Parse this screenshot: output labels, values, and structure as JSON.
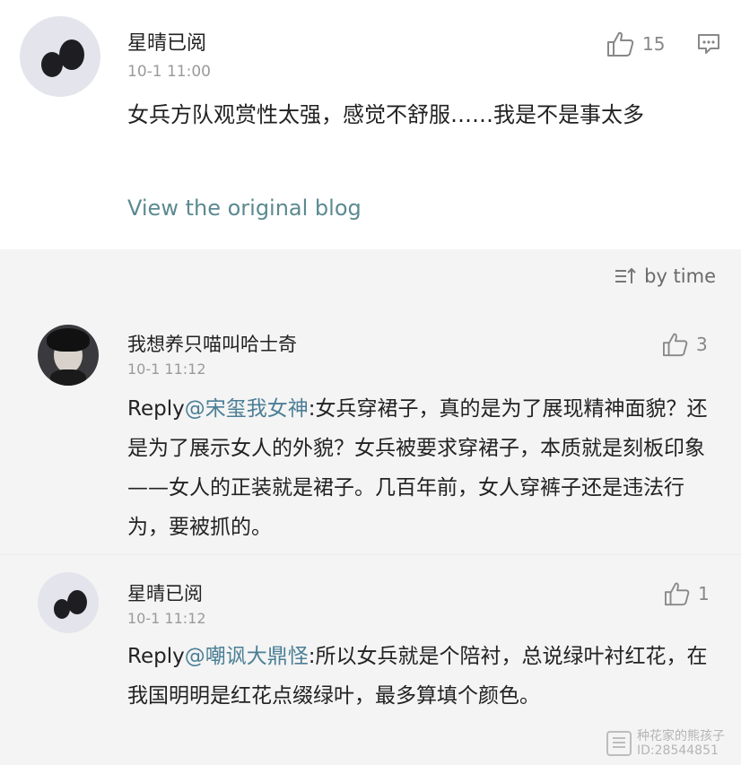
{
  "post": {
    "author": "星晴已阅",
    "time": "10-1 11:00",
    "likes": "15",
    "content": "女兵方队观赏性太强，感觉不舒服……我是不是事太多",
    "view_original": "View the original blog"
  },
  "sort": {
    "label": "by time"
  },
  "replies": [
    {
      "author": "我想养只喵叫哈士奇",
      "time": "10-1 11:12",
      "likes": "3",
      "reply_prefix": "Reply",
      "mention": "@宋玺我女神",
      "text": ":女兵穿裙子，真的是为了展现精神面貌？还是为了展示女人的外貌？女兵被要求穿裙子，本质就是刻板印象——女人的正装就是裙子。几百年前，女人穿裤子还是违法行为，要被抓的。"
    },
    {
      "author": "星晴已阅",
      "time": "10-1 11:12",
      "likes": "1",
      "reply_prefix": "Reply",
      "mention": "@嘲讽大鼎怪",
      "text": ":所以女兵就是个陪衬，总说绿叶衬红花，在我国明明是红花点缀绿叶，最多算填个颜色。"
    }
  ],
  "watermark": {
    "line1": "种花家的熊孩子",
    "line2": "ID:28544851"
  },
  "icons": {
    "like": "thumbs-up-icon",
    "comment": "comment-icon",
    "sort": "sort-icon"
  }
}
